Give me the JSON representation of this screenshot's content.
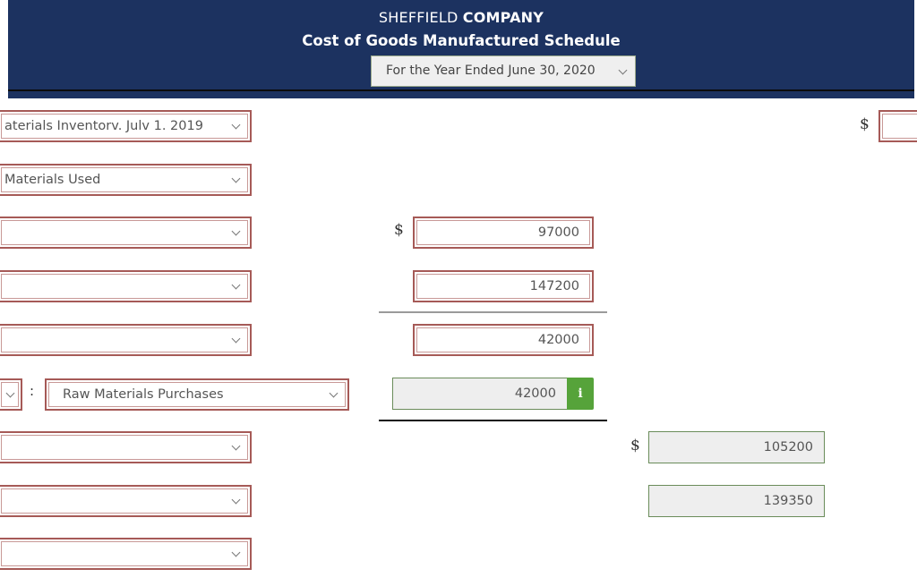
{
  "header": {
    "company_regular": "SHEFFIELD ",
    "company_bold": "COMPANY",
    "title": "Cost of Goods Manufactured Schedule",
    "period_select": "For the Year Ended June 30, 2020"
  },
  "colors": {
    "header_bg": "#1c3260",
    "input_border": "#a65a57",
    "calc_border": "#6a8c5a",
    "info_button": "#56a33a"
  },
  "rows": {
    "r1_label": "aterials Inventorv. Julv 1. 2019",
    "r2_label": "Materials Used",
    "r3_label": "",
    "r4_label": "",
    "r5_label": "",
    "r6_prefix_label": "",
    "r6_colon": ":",
    "r6_label": "Raw Materials Purchases",
    "r7_label": "",
    "r8_label": "",
    "r9_label": ""
  },
  "amounts": {
    "r1_right": "",
    "r3_mid": "97000",
    "r4_mid": "147200",
    "r5_mid": "42000",
    "r6_mid": "42000",
    "r7_right": "105200",
    "r8_right": "139350"
  },
  "symbols": {
    "dollar": "$",
    "info": "i"
  }
}
